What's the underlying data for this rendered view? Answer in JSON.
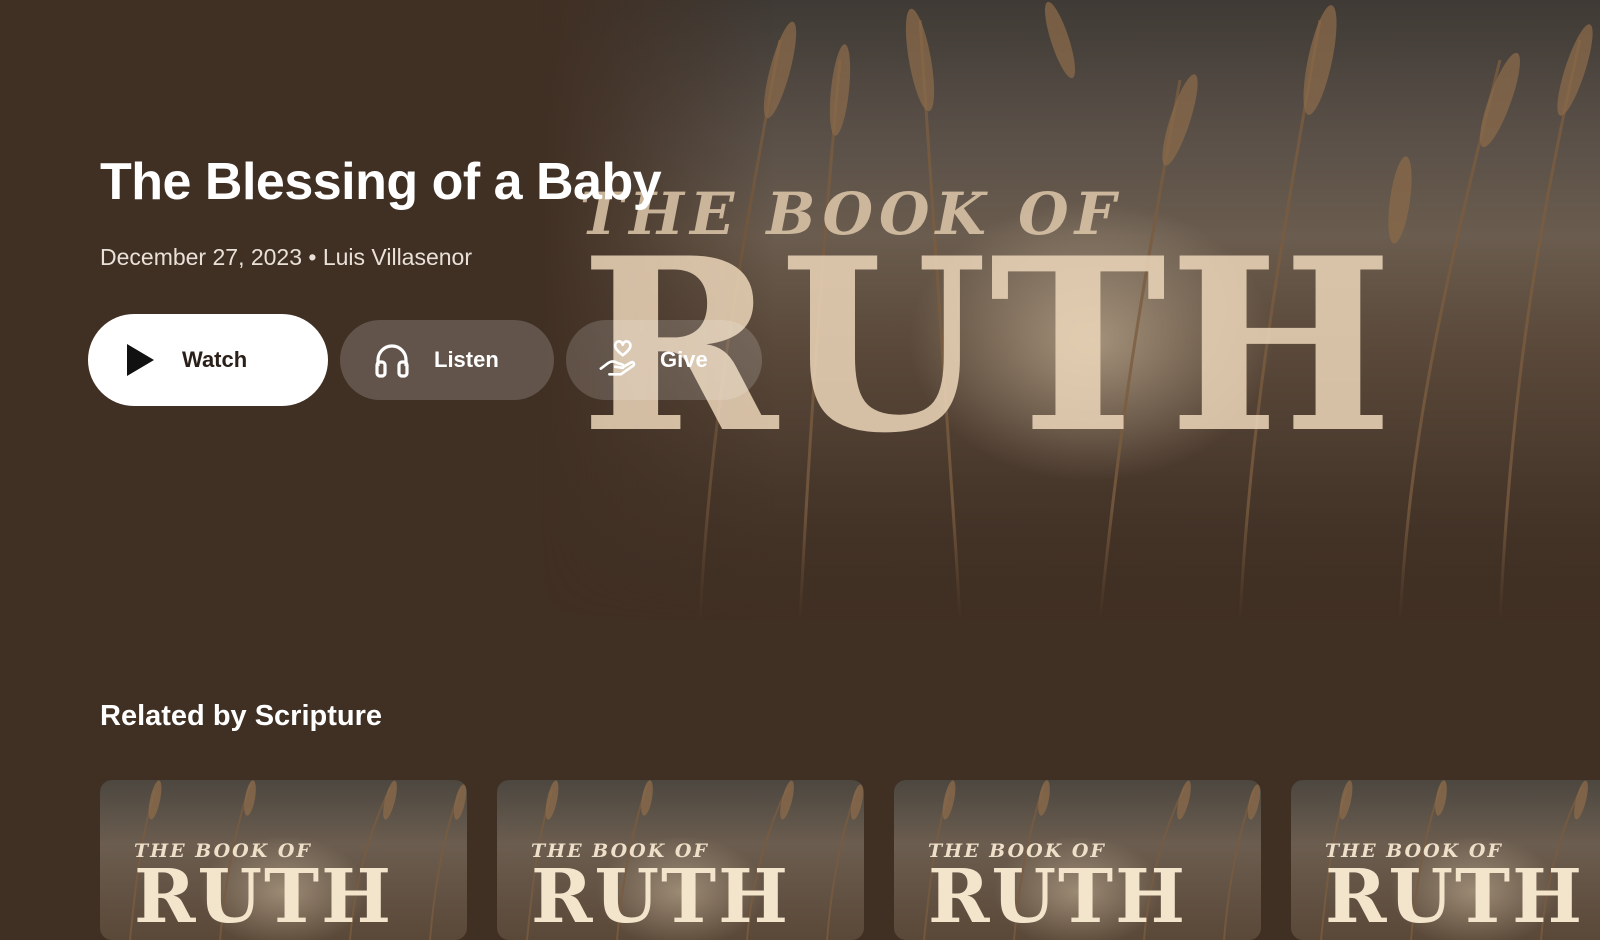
{
  "hero": {
    "title": "The Blessing of a Baby",
    "meta": "December 27, 2023 • Luis Villasenor",
    "artwork": {
      "kicker": "THE BOOK OF",
      "title": "RUTH"
    },
    "actions": [
      {
        "label": "Watch",
        "icon": "play-icon"
      },
      {
        "label": "Listen",
        "icon": "headphones-icon"
      },
      {
        "label": "Give",
        "icon": "heart-hand-icon"
      }
    ]
  },
  "related": {
    "title": "Related by Scripture",
    "items": [
      {
        "kicker": "THE BOOK OF",
        "title": "RUTH"
      },
      {
        "kicker": "THE BOOK OF",
        "title": "RUTH"
      },
      {
        "kicker": "THE BOOK OF",
        "title": "RUTH"
      },
      {
        "kicker": "THE BOOK OF",
        "title": "RUTH"
      }
    ]
  },
  "colors": {
    "background": "#402f23",
    "primary_button": "#ffffff",
    "text": "#ffffff"
  }
}
